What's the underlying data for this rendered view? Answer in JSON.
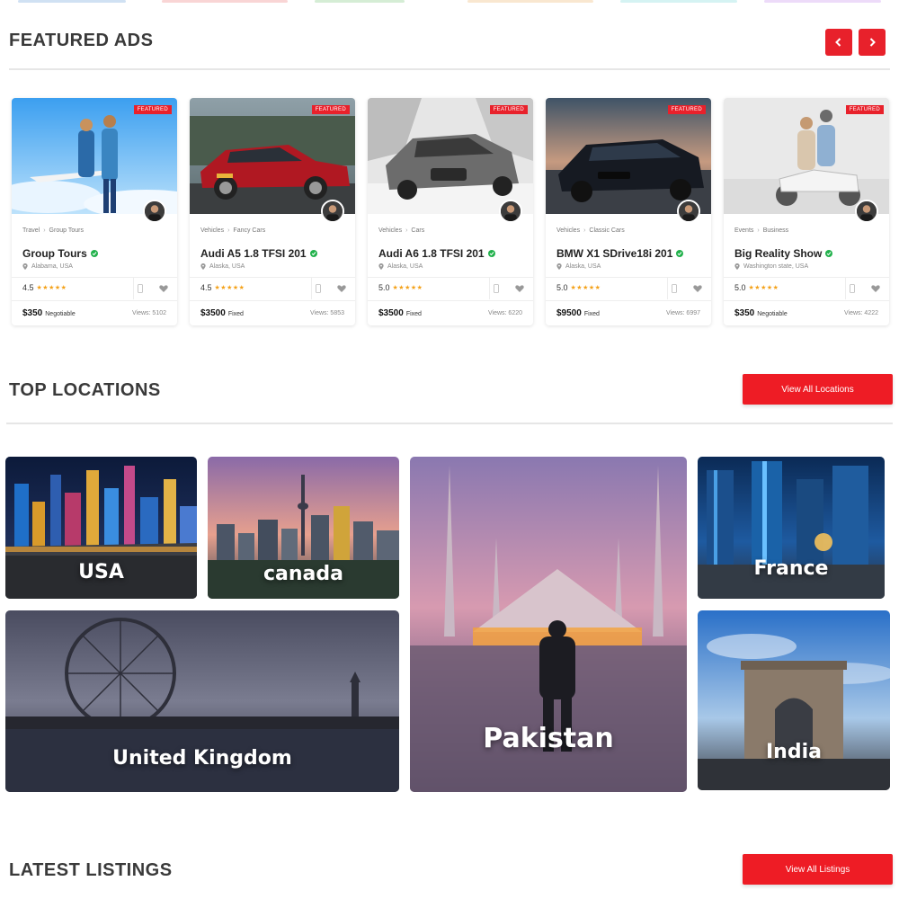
{
  "colors": {
    "accent": "#ee1c25",
    "verified": "#22b14c",
    "star": "#f4a21a"
  },
  "featured": {
    "title": "FEATURED ADS",
    "prev_icon": "chevron-left-icon",
    "next_icon": "chevron-right-icon",
    "cards": [
      {
        "badge": "FEATURED",
        "category": "Travel",
        "subcategory": "Group Tours",
        "title": "Group Tours",
        "location": "Alabama, USA",
        "rating": "4.5",
        "stars": "★★★★★",
        "price": "$350",
        "price_type": "Negotiable",
        "views": "Views: 5102"
      },
      {
        "badge": "FEATURED",
        "category": "Vehicles",
        "subcategory": "Fancy Cars",
        "title": "Audi A5 1.8 TFSI 201",
        "location": "Alaska, USA",
        "rating": "4.5",
        "stars": "★★★★★",
        "price": "$3500",
        "price_type": "Fixed",
        "views": "Views: 5853"
      },
      {
        "badge": "FEATURED",
        "category": "Vehicles",
        "subcategory": "Cars",
        "title": "Audi A6 1.8 TFSI 201",
        "location": "Alaska, USA",
        "rating": "5.0",
        "stars": "★★★★★",
        "price": "$3500",
        "price_type": "Fixed",
        "views": "Views: 6220"
      },
      {
        "badge": "FEATURED",
        "category": "Vehicles",
        "subcategory": "Classic Cars",
        "title": "BMW X1 SDrive18i 201",
        "location": "Alaska, USA",
        "rating": "5.0",
        "stars": "★★★★★",
        "price": "$9500",
        "price_type": "Fixed",
        "views": "Views: 6997"
      },
      {
        "badge": "FEATURED",
        "category": "Events",
        "subcategory": "Business",
        "title": "Big Reality Show",
        "location": "Washington state, USA",
        "rating": "5.0",
        "stars": "★★★★★",
        "price": "$350",
        "price_type": "Negotiable",
        "views": "Views: 4222"
      }
    ]
  },
  "locations": {
    "title": "TOP LOCATIONS",
    "button": "View All Locations",
    "tiles": [
      {
        "name": "USA"
      },
      {
        "name": "canada"
      },
      {
        "name": "Pakistan"
      },
      {
        "name": "France"
      },
      {
        "name": "United Kingdom"
      },
      {
        "name": "India"
      }
    ]
  },
  "latest": {
    "title": "LATEST LISTINGS",
    "button": "View All Listings"
  }
}
